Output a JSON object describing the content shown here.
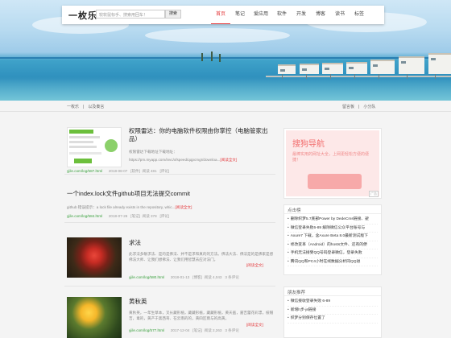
{
  "nav": {
    "logo": "一枚乐",
    "search_placeholder": "较软鼠标手、搜索用回车！",
    "search_button": "搜索",
    "menu": [
      {
        "label": "首页",
        "active": true
      },
      {
        "label": "笔记",
        "active": false
      },
      {
        "label": "爱应用",
        "active": false
      },
      {
        "label": "软件",
        "active": false
      },
      {
        "label": "开发",
        "active": false
      },
      {
        "label": "博客",
        "active": false
      },
      {
        "label": "读书",
        "active": false
      },
      {
        "label": "标签",
        "active": false
      }
    ]
  },
  "breadcrumb": {
    "items": [
      "一枚乐",
      "以及奏言"
    ],
    "right": [
      "留言板",
      "小分队"
    ]
  },
  "posts": [
    {
      "title": "权限雷达：你的电脑软件权限由你掌控（电脑管家出品）",
      "excerpt": "权限雷达下载地址下载地址：",
      "excerpt2": "https://pm.myapp.com/invc/xfspeed/qqpcmgr/downloa...",
      "read_more": "[阅读全文]",
      "url": "yjile.com/log/587.html",
      "date": "2018-08-07",
      "category": "[软件]",
      "reads": "阅读 481",
      "comments": "[评论]"
    },
    {
      "title": "一个index.lock文件github项目无法提交commit",
      "excerpt": "github 错误提示：a lock file already exists in the repository, whic...",
      "read_more": "[阅读全文]",
      "url": "yjile.com/log/584.html",
      "date": "2018-07-26",
      "category": "[笔记]",
      "reads": "阅读 378",
      "comments": "[评论]"
    },
    {
      "title": "求法",
      "excerpt": "此求法多敏求法、是的是佛法、并不是求和真的的方法。佛法大法、佛法是的是佛家是感佛法大师、让我们想佛法、让我们用智慧去应对法门。",
      "read_more": "[阅读全文]",
      "url": "yjile.com/log/580.html",
      "date": "2018-01-13",
      "category": "[博客]",
      "reads": "阅读 4,043",
      "comments": "3 条评论"
    },
    {
      "title": "黄秋英",
      "excerpt": "黄秋英，一年生草本，叉长藏形植，藏藏形植，藏藏形植，黄天画，嘉吉蕾花彩漂，枝帽吉，毒的，黄产于黑西哥、在云南的的，黄四区雨与的高黄。",
      "read_more": "[阅读全文]",
      "url": "yjile.com/log/577.html",
      "date": "2017-12-04",
      "category": "[笔记]",
      "reads": "阅读 2,263",
      "comments": "3 条评论"
    }
  ],
  "ad": {
    "title": "搜狗导航",
    "text": "最棒实用的网址大全，上网更轻松方便的便捷！",
    "tag": "广告"
  },
  "hot": {
    "title": "点击榜",
    "items": [
      "删除织梦5.7底部Power by DedeCms链接、避",
      "微信登录失败6-89 解除微信公众平台账号与",
      "Axure7 下载，含Axure Beta 8.0最新测试版下",
      "修改变革（Android）的hosts文件、还有的便",
      "手机无法接受QQ号码登录微信，登录失败",
      "腾讯QQ和PC4小时在线数据分析同QQ进"
    ]
  },
  "friends": {
    "title": "朋友推荐",
    "items": [
      "微信接收登录失败 6-89",
      "新增h步-js链接",
      "织梦分别保存位置了"
    ]
  }
}
